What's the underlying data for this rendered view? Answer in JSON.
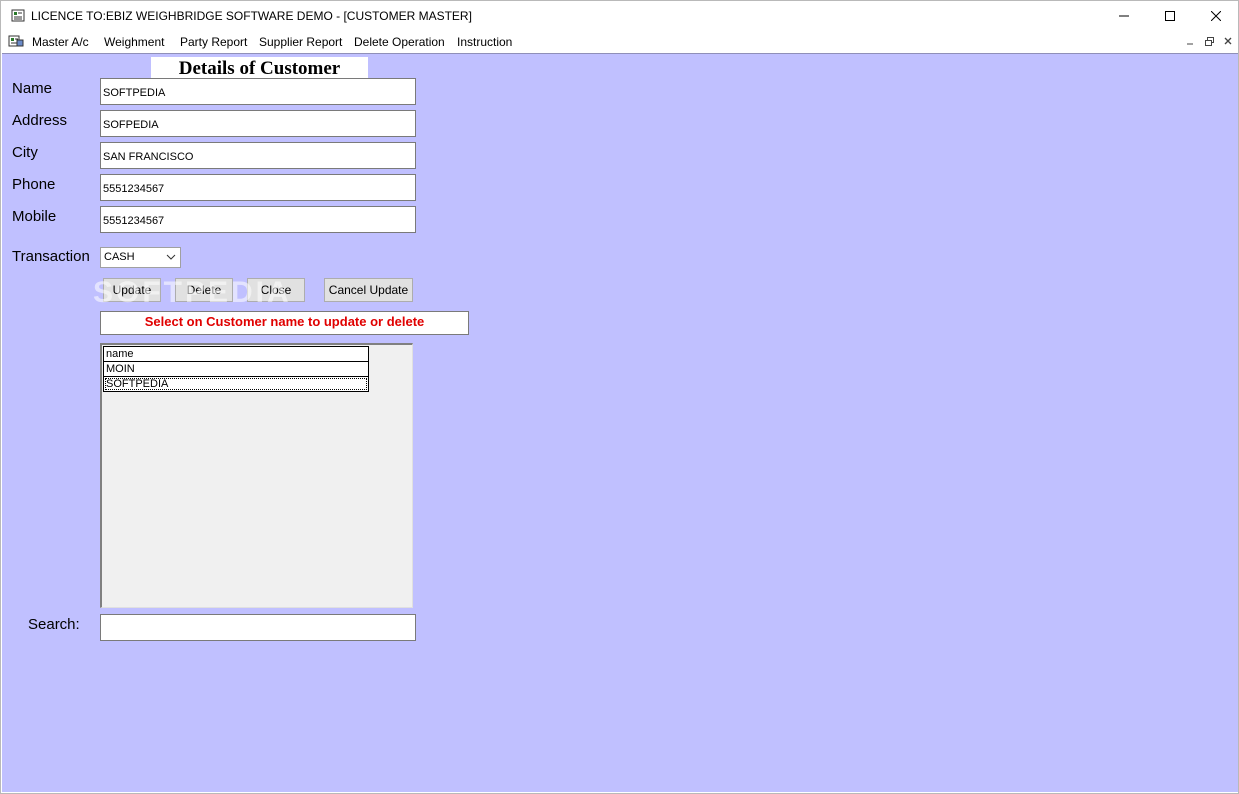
{
  "window": {
    "title": "LICENCE TO:EBIZ WEIGHBRIDGE SOFTWARE DEMO - [CUSTOMER MASTER]"
  },
  "menu": {
    "items": [
      "Master A/c",
      "Weighment",
      "Party Report",
      "Supplier Report",
      "Delete Operation",
      "Instruction"
    ]
  },
  "form": {
    "heading": "Details of Customer",
    "fields": [
      {
        "label": "Name",
        "value": "SOFTPEDIA"
      },
      {
        "label": "Address",
        "value": "SOFPEDIA"
      },
      {
        "label": "City",
        "value": "SAN FRANCISCO"
      },
      {
        "label": "Phone",
        "value": "5551234567"
      },
      {
        "label": "Mobile",
        "value": "5551234567"
      }
    ],
    "transaction": {
      "label": "Transaction",
      "selected": "CASH"
    },
    "buttons": {
      "update": "Update",
      "delete": "Delete",
      "close": "Close",
      "cancel_update": "Cancel Update"
    },
    "message": "Select on Customer name to update or delete",
    "grid": {
      "header": "name",
      "rows": [
        "MOIN",
        "SOFTPEDIA"
      ]
    },
    "search": {
      "label": "Search:",
      "value": ""
    }
  },
  "watermark": "SOFTPEDIA",
  "colors": {
    "client_background": "#c0c0ff",
    "message_text": "#e00000"
  }
}
